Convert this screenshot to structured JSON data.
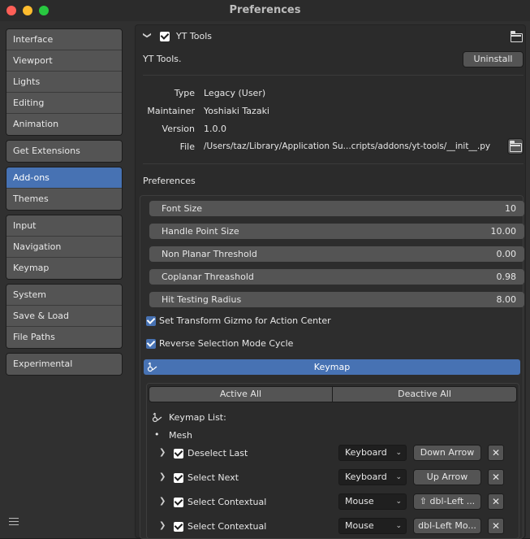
{
  "window": {
    "title": "Preferences",
    "traffic": {
      "close": "#fe5f57",
      "min": "#febc2e",
      "max": "#28c840"
    }
  },
  "sidebar": {
    "groups": [
      [
        {
          "label": "Interface"
        },
        {
          "label": "Viewport"
        },
        {
          "label": "Lights"
        },
        {
          "label": "Editing"
        },
        {
          "label": "Animation"
        }
      ],
      [
        {
          "label": "Get Extensions"
        }
      ],
      [
        {
          "label": "Add-ons",
          "active": true
        },
        {
          "label": "Themes"
        }
      ],
      [
        {
          "label": "Input"
        },
        {
          "label": "Navigation"
        },
        {
          "label": "Keymap"
        }
      ],
      [
        {
          "label": "System"
        },
        {
          "label": "Save & Load"
        },
        {
          "label": "File Paths"
        }
      ],
      [
        {
          "label": "Experimental"
        }
      ]
    ]
  },
  "addon": {
    "name": "YT Tools",
    "description": "YT Tools.",
    "uninstall": "Uninstall",
    "type_label": "Type",
    "type_value": "Legacy (User)",
    "maintainer_label": "Maintainer",
    "maintainer_value": "Yoshiaki Tazaki",
    "version_label": "Version",
    "version_value": "1.0.0",
    "file_label": "File",
    "file_value": "/Users/taz/Library/Application Su...cripts/addons/yt-tools/__init__.py"
  },
  "preferences": {
    "heading": "Preferences",
    "fields": [
      {
        "label": "Font Size",
        "value": "10"
      },
      {
        "label": "Handle Point Size",
        "value": "10.00"
      },
      {
        "label": "Non Planar Threshold",
        "value": "0.00"
      },
      {
        "label": "Coplanar Threashold",
        "value": "0.98"
      },
      {
        "label": "Hit Testing Radius",
        "value": "8.00"
      }
    ],
    "checks": [
      {
        "label": "Set Transform Gizmo for Action Center",
        "checked": true
      },
      {
        "label": "Reverse Selection Mode Cycle",
        "checked": true
      }
    ],
    "keymap_label": "Keymap",
    "active_all": "Active All",
    "deactive_all": "Deactive All",
    "keymap_list": "Keymap List:",
    "mesh_label": "Mesh",
    "rows": [
      {
        "name": "Deselect Last",
        "device": "Keyboard",
        "key": "Down Arrow"
      },
      {
        "name": "Select Next",
        "device": "Keyboard",
        "key": "Up Arrow"
      },
      {
        "name": "Select Contextual",
        "device": "Mouse",
        "key": "⇧ dbl-Left ..."
      },
      {
        "name": "Select Contextual",
        "device": "Mouse",
        "key": "dbl-Left Mo..."
      }
    ]
  }
}
